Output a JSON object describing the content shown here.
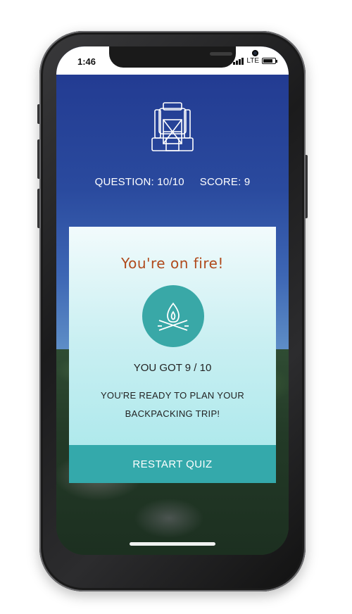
{
  "status_bar": {
    "time": "1:46",
    "network": "LTE",
    "signal_bars": 4
  },
  "header": {
    "icon": "backpack-icon",
    "question_label": "QUESTION: 10/10",
    "score_label": "SCORE: 9"
  },
  "result_card": {
    "title": "You're on fire!",
    "icon": "campfire-icon",
    "score_text": "YOU GOT 9 / 10",
    "message_line1": "YOU'RE READY TO PLAN YOUR",
    "message_line2": "BACKPACKING TRIP!",
    "restart_label": "RESTART QUIZ"
  },
  "colors": {
    "title": "#b04a1c",
    "badge": "#39a8a7",
    "button": "#34a9ab",
    "sky_top": "#21388f"
  }
}
